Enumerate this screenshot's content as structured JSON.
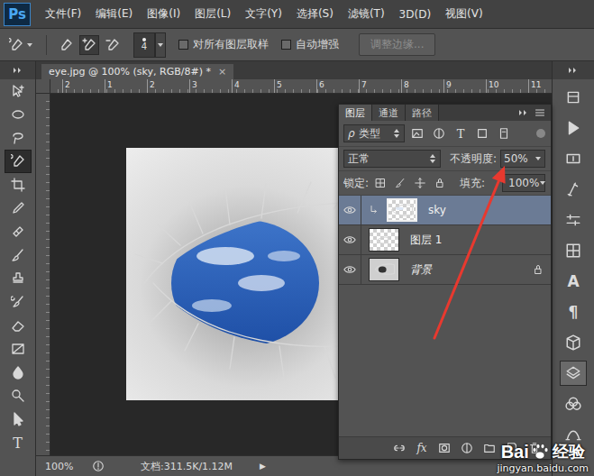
{
  "app": {
    "logo": "Ps"
  },
  "menu": [
    {
      "label": "文件(F)"
    },
    {
      "label": "编辑(E)"
    },
    {
      "label": "图像(I)"
    },
    {
      "label": "图层(L)"
    },
    {
      "label": "文字(Y)"
    },
    {
      "label": "选择(S)"
    },
    {
      "label": "滤镜(T)"
    },
    {
      "label": "3D(D)"
    },
    {
      "label": "视图(V)"
    }
  ],
  "options": {
    "current_tool": {
      "kind": "quick-select"
    },
    "tool_presets": [
      {
        "kind": "new",
        "selected": false
      },
      {
        "kind": "add",
        "selected": true
      },
      {
        "kind": "subtract",
        "selected": false
      }
    ],
    "brush_size": "4",
    "checkboxes": [
      {
        "label": "对所有图层取样",
        "checked": false
      },
      {
        "label": "自动增强",
        "checked": false
      }
    ],
    "refine_button": {
      "label": "调整边缘...",
      "disabled": true
    }
  },
  "toolbox": {
    "tools": [
      {
        "kind": "move",
        "selected": false
      },
      {
        "kind": "marquee",
        "selected": false
      },
      {
        "kind": "lasso",
        "selected": false
      },
      {
        "kind": "quick-select",
        "selected": true
      },
      {
        "kind": "crop",
        "selected": false
      },
      {
        "kind": "eyedropper",
        "selected": false
      },
      {
        "kind": "healing",
        "selected": false
      },
      {
        "kind": "brush",
        "selected": false
      },
      {
        "kind": "stamp",
        "selected": false
      },
      {
        "kind": "history-brush",
        "selected": false
      },
      {
        "kind": "eraser",
        "selected": false
      },
      {
        "kind": "gradient",
        "selected": false
      },
      {
        "kind": "blur",
        "selected": false
      },
      {
        "kind": "dodge",
        "selected": false
      },
      {
        "kind": "path-select",
        "selected": false
      },
      {
        "kind": "type",
        "glyph": "T",
        "selected": false
      }
    ]
  },
  "document": {
    "tab": {
      "title": "eye.jpg @ 100% (sky, RGB/8#) *",
      "close": "×",
      "selected": true
    },
    "ruler": [
      "2",
      "1",
      "2",
      "3",
      "4",
      "5",
      "6",
      "7",
      "8",
      "9",
      "10",
      "11"
    ]
  },
  "layers_panel": {
    "tabs": [
      {
        "label": "图层",
        "selected": true
      },
      {
        "label": "通道",
        "selected": false
      },
      {
        "label": "路径",
        "selected": false
      }
    ],
    "filter": {
      "glyph": "ρ",
      "label": "类型",
      "icons": [
        {
          "kind": "image"
        },
        {
          "kind": "adjust"
        },
        {
          "kind": "type",
          "glyph": "T"
        },
        {
          "kind": "shape"
        },
        {
          "kind": "smart"
        }
      ]
    },
    "blend_mode": "正常",
    "opacity_label": "不透明度:",
    "opacity": "50%",
    "lock_label": "锁定:",
    "lock_icons": [
      {
        "kind": "pixels"
      },
      {
        "kind": "paint"
      },
      {
        "kind": "position"
      },
      {
        "kind": "all"
      }
    ],
    "fill_label": "填充:",
    "fill": "100%",
    "layers": [
      {
        "name": "sky",
        "selected": true,
        "visible": true,
        "clipped": true,
        "locked": false,
        "italic": false,
        "thumbnail": "sky"
      },
      {
        "name": "图层 1",
        "selected": false,
        "visible": true,
        "clipped": false,
        "locked": false,
        "italic": false,
        "thumbnail": "layer"
      },
      {
        "name": "背景",
        "selected": false,
        "visible": true,
        "clipped": false,
        "locked": true,
        "italic": true,
        "thumbnail": "photo"
      }
    ],
    "bottom_icons": [
      {
        "kind": "link"
      },
      {
        "kind": "fx",
        "glyph": "fx"
      },
      {
        "kind": "mask"
      },
      {
        "kind": "adjust"
      },
      {
        "kind": "folder"
      },
      {
        "kind": "new-layer"
      },
      {
        "kind": "trash"
      }
    ]
  },
  "dock": {
    "icons": [
      {
        "kind": "history",
        "selected": false
      },
      {
        "kind": "actions",
        "selected": false
      },
      {
        "kind": "info",
        "selected": false
      },
      {
        "kind": "brushes",
        "selected": false
      },
      {
        "kind": "adjustments",
        "selected": false
      },
      {
        "kind": "swatches",
        "selected": false
      },
      {
        "kind": "character",
        "glyph": "A",
        "selected": false
      },
      {
        "kind": "paragraph",
        "glyph": "¶",
        "selected": false
      },
      {
        "kind": "3d",
        "selected": false
      },
      {
        "kind": "layers",
        "selected": true
      },
      {
        "kind": "channels",
        "selected": false
      },
      {
        "kind": "paths",
        "selected": false
      }
    ]
  },
  "status_bar": {
    "zoom": "100%",
    "doc": "文档:311.5K/1.12M",
    "arrow": "▶"
  },
  "watermark": {
    "brand": "Bai",
    "product": "经验",
    "url": "jingyan.baidu.com"
  }
}
